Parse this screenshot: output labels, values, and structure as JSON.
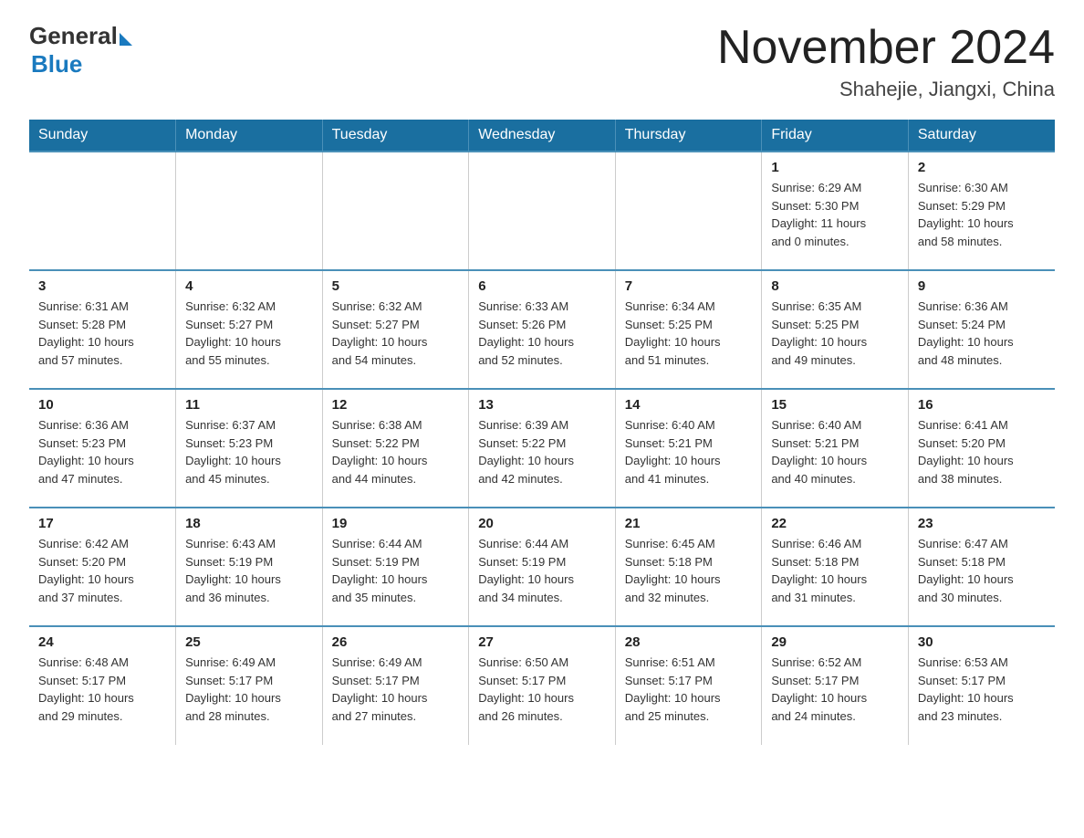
{
  "header": {
    "logo": {
      "general": "General",
      "blue": "Blue"
    },
    "month": "November 2024",
    "location": "Shahejie, Jiangxi, China"
  },
  "weekdays": [
    "Sunday",
    "Monday",
    "Tuesday",
    "Wednesday",
    "Thursday",
    "Friday",
    "Saturday"
  ],
  "weeks": [
    [
      {
        "day": "",
        "info": ""
      },
      {
        "day": "",
        "info": ""
      },
      {
        "day": "",
        "info": ""
      },
      {
        "day": "",
        "info": ""
      },
      {
        "day": "",
        "info": ""
      },
      {
        "day": "1",
        "info": "Sunrise: 6:29 AM\nSunset: 5:30 PM\nDaylight: 11 hours\nand 0 minutes."
      },
      {
        "day": "2",
        "info": "Sunrise: 6:30 AM\nSunset: 5:29 PM\nDaylight: 10 hours\nand 58 minutes."
      }
    ],
    [
      {
        "day": "3",
        "info": "Sunrise: 6:31 AM\nSunset: 5:28 PM\nDaylight: 10 hours\nand 57 minutes."
      },
      {
        "day": "4",
        "info": "Sunrise: 6:32 AM\nSunset: 5:27 PM\nDaylight: 10 hours\nand 55 minutes."
      },
      {
        "day": "5",
        "info": "Sunrise: 6:32 AM\nSunset: 5:27 PM\nDaylight: 10 hours\nand 54 minutes."
      },
      {
        "day": "6",
        "info": "Sunrise: 6:33 AM\nSunset: 5:26 PM\nDaylight: 10 hours\nand 52 minutes."
      },
      {
        "day": "7",
        "info": "Sunrise: 6:34 AM\nSunset: 5:25 PM\nDaylight: 10 hours\nand 51 minutes."
      },
      {
        "day": "8",
        "info": "Sunrise: 6:35 AM\nSunset: 5:25 PM\nDaylight: 10 hours\nand 49 minutes."
      },
      {
        "day": "9",
        "info": "Sunrise: 6:36 AM\nSunset: 5:24 PM\nDaylight: 10 hours\nand 48 minutes."
      }
    ],
    [
      {
        "day": "10",
        "info": "Sunrise: 6:36 AM\nSunset: 5:23 PM\nDaylight: 10 hours\nand 47 minutes."
      },
      {
        "day": "11",
        "info": "Sunrise: 6:37 AM\nSunset: 5:23 PM\nDaylight: 10 hours\nand 45 minutes."
      },
      {
        "day": "12",
        "info": "Sunrise: 6:38 AM\nSunset: 5:22 PM\nDaylight: 10 hours\nand 44 minutes."
      },
      {
        "day": "13",
        "info": "Sunrise: 6:39 AM\nSunset: 5:22 PM\nDaylight: 10 hours\nand 42 minutes."
      },
      {
        "day": "14",
        "info": "Sunrise: 6:40 AM\nSunset: 5:21 PM\nDaylight: 10 hours\nand 41 minutes."
      },
      {
        "day": "15",
        "info": "Sunrise: 6:40 AM\nSunset: 5:21 PM\nDaylight: 10 hours\nand 40 minutes."
      },
      {
        "day": "16",
        "info": "Sunrise: 6:41 AM\nSunset: 5:20 PM\nDaylight: 10 hours\nand 38 minutes."
      }
    ],
    [
      {
        "day": "17",
        "info": "Sunrise: 6:42 AM\nSunset: 5:20 PM\nDaylight: 10 hours\nand 37 minutes."
      },
      {
        "day": "18",
        "info": "Sunrise: 6:43 AM\nSunset: 5:19 PM\nDaylight: 10 hours\nand 36 minutes."
      },
      {
        "day": "19",
        "info": "Sunrise: 6:44 AM\nSunset: 5:19 PM\nDaylight: 10 hours\nand 35 minutes."
      },
      {
        "day": "20",
        "info": "Sunrise: 6:44 AM\nSunset: 5:19 PM\nDaylight: 10 hours\nand 34 minutes."
      },
      {
        "day": "21",
        "info": "Sunrise: 6:45 AM\nSunset: 5:18 PM\nDaylight: 10 hours\nand 32 minutes."
      },
      {
        "day": "22",
        "info": "Sunrise: 6:46 AM\nSunset: 5:18 PM\nDaylight: 10 hours\nand 31 minutes."
      },
      {
        "day": "23",
        "info": "Sunrise: 6:47 AM\nSunset: 5:18 PM\nDaylight: 10 hours\nand 30 minutes."
      }
    ],
    [
      {
        "day": "24",
        "info": "Sunrise: 6:48 AM\nSunset: 5:17 PM\nDaylight: 10 hours\nand 29 minutes."
      },
      {
        "day": "25",
        "info": "Sunrise: 6:49 AM\nSunset: 5:17 PM\nDaylight: 10 hours\nand 28 minutes."
      },
      {
        "day": "26",
        "info": "Sunrise: 6:49 AM\nSunset: 5:17 PM\nDaylight: 10 hours\nand 27 minutes."
      },
      {
        "day": "27",
        "info": "Sunrise: 6:50 AM\nSunset: 5:17 PM\nDaylight: 10 hours\nand 26 minutes."
      },
      {
        "day": "28",
        "info": "Sunrise: 6:51 AM\nSunset: 5:17 PM\nDaylight: 10 hours\nand 25 minutes."
      },
      {
        "day": "29",
        "info": "Sunrise: 6:52 AM\nSunset: 5:17 PM\nDaylight: 10 hours\nand 24 minutes."
      },
      {
        "day": "30",
        "info": "Sunrise: 6:53 AM\nSunset: 5:17 PM\nDaylight: 10 hours\nand 23 minutes."
      }
    ]
  ]
}
